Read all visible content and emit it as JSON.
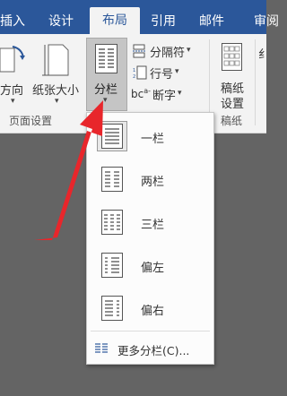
{
  "tabs": [
    "插入",
    "设计",
    "布局",
    "引用",
    "邮件",
    "审阅"
  ],
  "ribbon": {
    "orientation": "方向",
    "orientation_arrow": "▾",
    "paper_size": "纸张大小",
    "paper_size_arrow": "▾",
    "columns": "分栏",
    "columns_arrow": "▾",
    "breaks": "分隔符",
    "breaks_arrow": "▾",
    "line_numbers": "行号",
    "line_numbers_arrow": "▾",
    "hyphenation": "断字",
    "hyphenation_arrow": "▾",
    "hyphen_icon_text": "bc",
    "hyphen_icon_sup": "a-",
    "draft_line1": "稿纸",
    "draft_line2": "设置",
    "page_setup_group": "页面设置",
    "draft_group": "稿纸",
    "right_edge_text": "纟"
  },
  "dropdown": {
    "items": [
      "一栏",
      "两栏",
      "三栏",
      "偏左",
      "偏右"
    ],
    "more": "更多分栏(C)..."
  },
  "colors": {
    "ribbon_blue": "#2b579a",
    "arrow_red": "#e8262b"
  }
}
